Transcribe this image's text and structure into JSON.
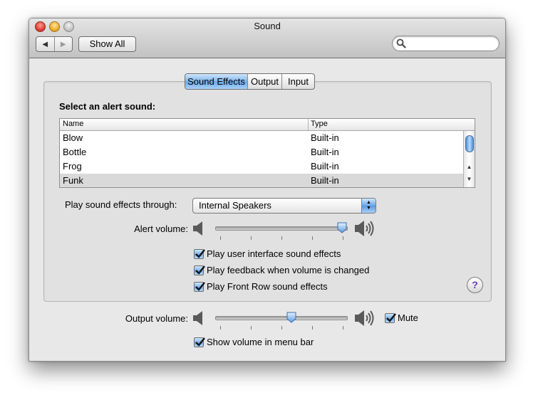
{
  "window": {
    "title": "Sound"
  },
  "toolbar": {
    "back_glyph": "◀",
    "forward_glyph": "▶",
    "show_all_label": "Show All",
    "search_placeholder": ""
  },
  "tabs": [
    {
      "label": "Sound Effects",
      "active": true
    },
    {
      "label": "Output",
      "active": false
    },
    {
      "label": "Input",
      "active": false
    }
  ],
  "alerts": {
    "heading": "Select an alert sound:",
    "columns": [
      "Name",
      "Type"
    ],
    "rows": [
      {
        "name": "Blow",
        "type": "Built-in",
        "selected": false
      },
      {
        "name": "Bottle",
        "type": "Built-in",
        "selected": false
      },
      {
        "name": "Frog",
        "type": "Built-in",
        "selected": false
      },
      {
        "name": "Funk",
        "type": "Built-in",
        "selected": true
      }
    ]
  },
  "play_through": {
    "label": "Play sound effects through:",
    "value": "Internal Speakers"
  },
  "alert_volume": {
    "label": "Alert volume:",
    "level": 0.97
  },
  "checkboxes": [
    {
      "label": "Play user interface sound effects",
      "checked": true
    },
    {
      "label": "Play feedback when volume is changed",
      "checked": true
    },
    {
      "label": "Play Front Row sound effects",
      "checked": true
    }
  ],
  "help_label": "?",
  "output_volume": {
    "label": "Output volume:",
    "level": 0.58,
    "mute_label": "Mute",
    "mute_checked": true
  },
  "menu_bar": {
    "label": "Show volume in menu bar",
    "checked": true
  },
  "colors": {
    "accent": "#6aa6e8",
    "selection": "#d9d9d9"
  },
  "icons": [
    "search-icon",
    "speaker-low-icon",
    "speaker-high-icon",
    "help-icon",
    "checkmark-icon"
  ]
}
